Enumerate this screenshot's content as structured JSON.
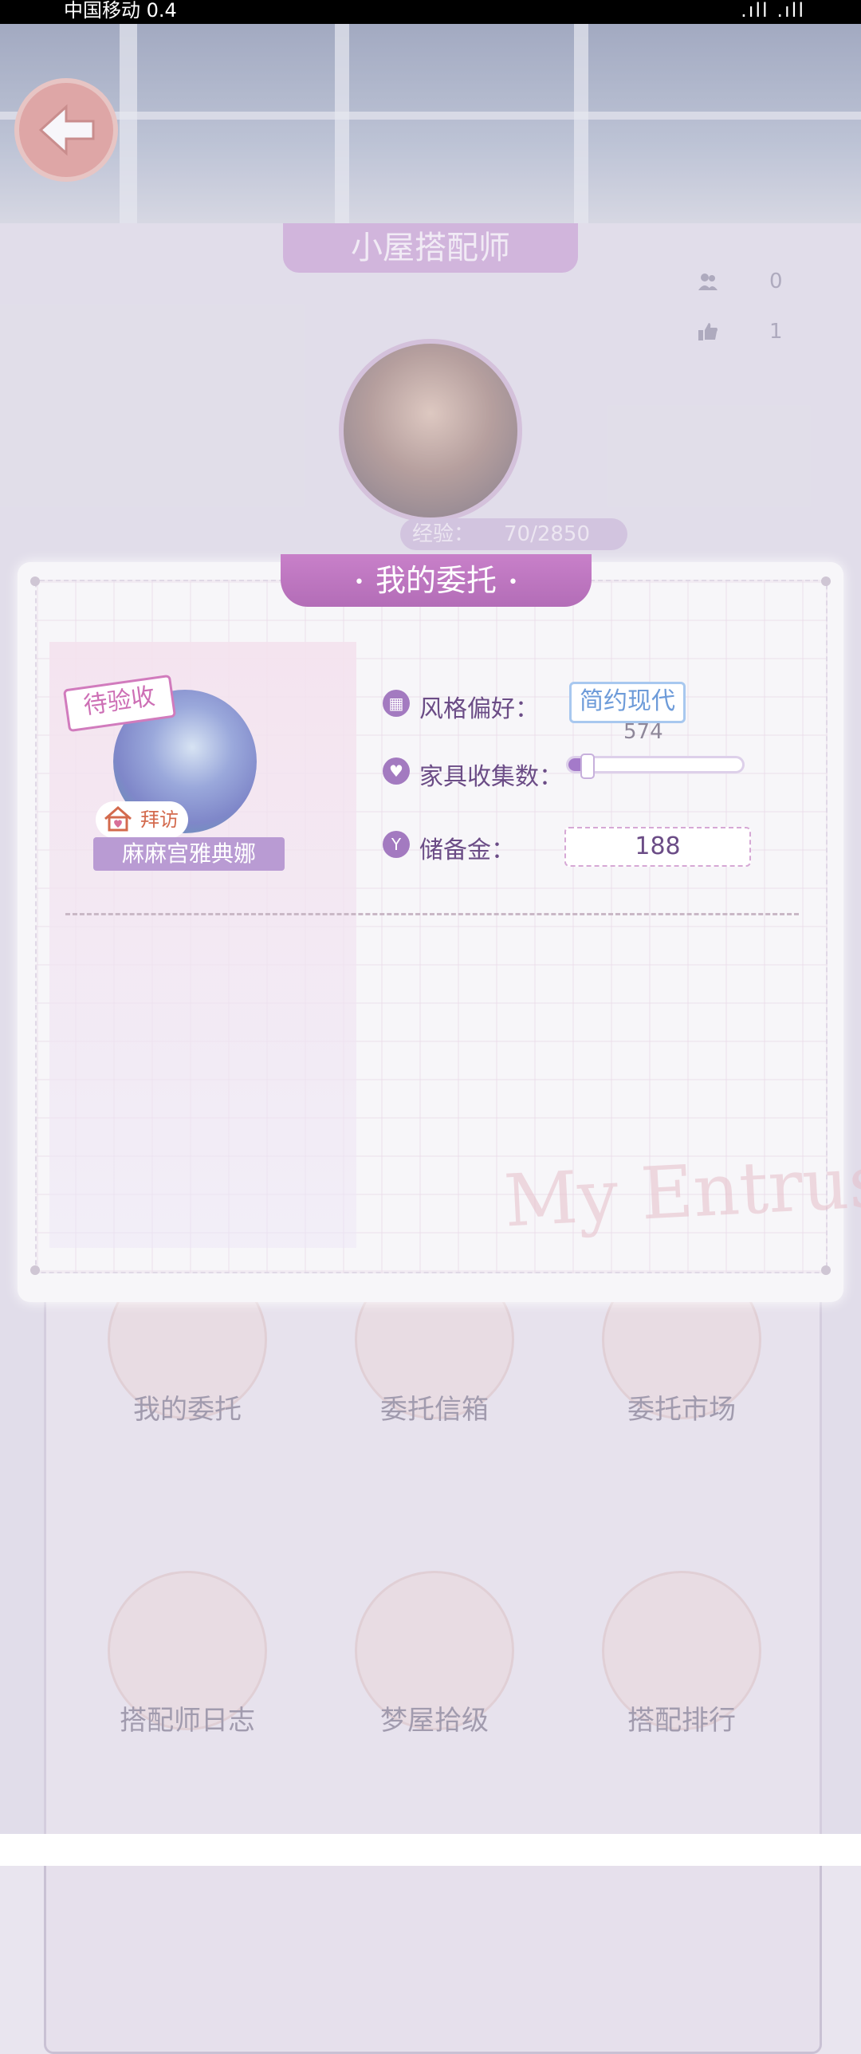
{
  "status_bar": {
    "carrier": "中国移动 0.4",
    "right_text": ".ıll .ıll"
  },
  "background": {
    "header_title": "小屋搭配师",
    "counters": [
      {
        "icon": "people-icon",
        "value": "0"
      },
      {
        "icon": "thumbs-up-icon",
        "value": "1"
      }
    ],
    "exp_label": "经验：",
    "exp_value": "70/2850",
    "menu": [
      {
        "label": "我的委托"
      },
      {
        "label": "委托信箱"
      },
      {
        "label": "委托市场"
      },
      {
        "label": "搭配师日志"
      },
      {
        "label": "梦屋拾级"
      },
      {
        "label": "搭配排行"
      }
    ]
  },
  "modal": {
    "title": "我的委托",
    "title_decor": "•",
    "pending_tag": "待验收",
    "visit_label": "拜访",
    "client_name": "麻麻宫雅典娜",
    "style_label": "风格偏好：",
    "style_value": "简约现代",
    "furniture_label": "家具收集数：",
    "furniture_value": "574",
    "furniture_progress": 0.1,
    "reserve_label": "储备金：",
    "reserve_value": "188",
    "watermark": "My Entrustment"
  },
  "colors": {
    "modal_title_bg": "#b36db7",
    "accent_purple": "#a37ac0",
    "back_button": "#d9857e"
  }
}
